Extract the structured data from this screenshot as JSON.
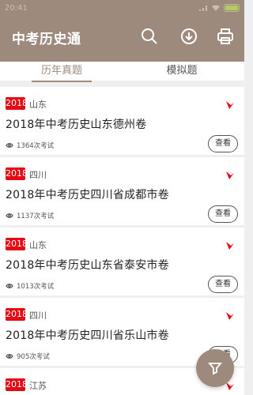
{
  "status": {
    "time": "20:41",
    "battery_label": ""
  },
  "app": {
    "title": "中考历史通"
  },
  "toolbar": {
    "search_icon": "search-icon",
    "download_icon": "download-icon",
    "print_icon": "print-icon"
  },
  "tabs": [
    {
      "label": "历年真题",
      "active": true
    },
    {
      "label": "模拟题",
      "active": false
    }
  ],
  "items": [
    {
      "year": "2018",
      "region": "山东",
      "title": "2018年中考历史山东德州卷",
      "views": "1364次考试",
      "action": "查看"
    },
    {
      "year": "2018",
      "region": "四川",
      "title": "2018年中考历史四川省成都市卷",
      "views": "1137次考试",
      "action": "查看"
    },
    {
      "year": "2018",
      "region": "山东",
      "title": "2018年中考历史山东省泰安市卷",
      "views": "1013次考试",
      "action": "查看"
    },
    {
      "year": "2018",
      "region": "四川",
      "title": "2018年中考历史四川省乐山市卷",
      "views": "905次考试",
      "action": "查看"
    },
    {
      "year": "2018",
      "region": "江苏",
      "title": "",
      "views": "",
      "action": ""
    }
  ],
  "fab": {
    "icon": "filter-icon"
  },
  "colors": {
    "primary": "#9e8a7d",
    "badge": "#e50914",
    "background": "#efefef"
  }
}
